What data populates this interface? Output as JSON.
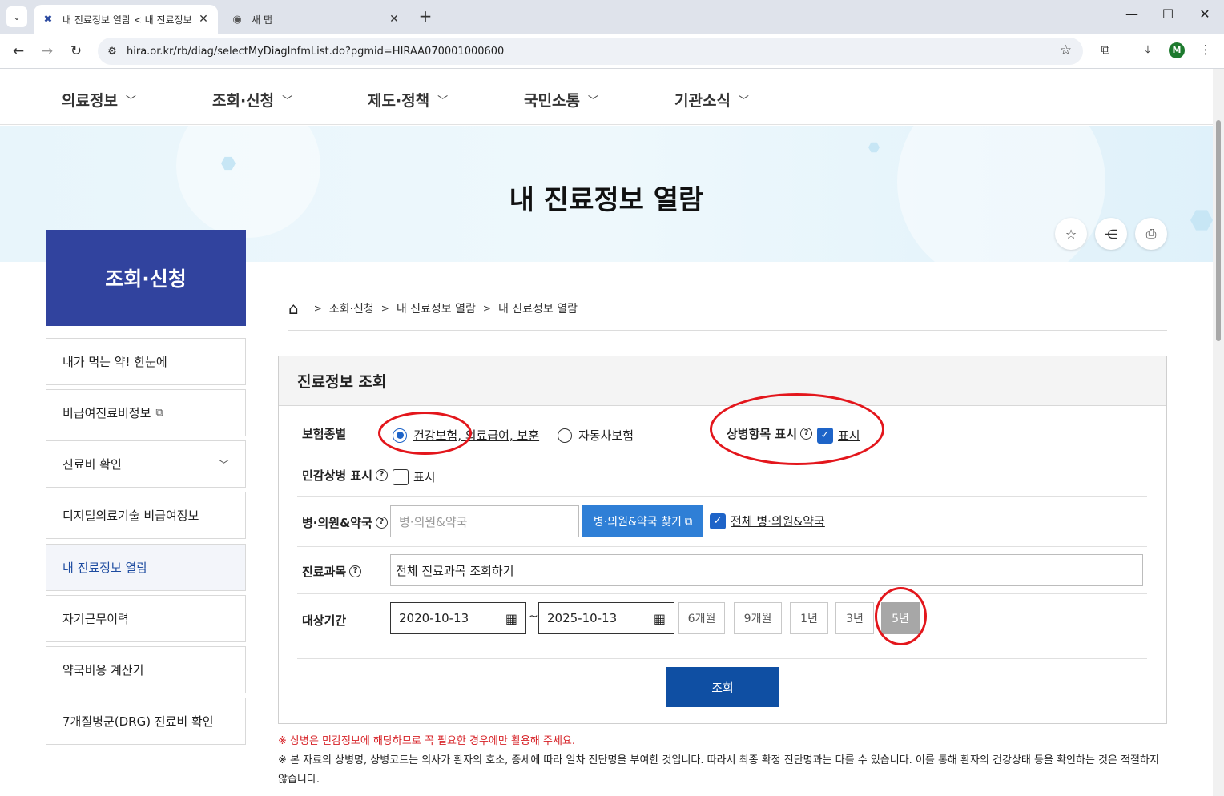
{
  "browser": {
    "tabs": [
      {
        "title": "내 진료정보 열람 < 내 진료정보",
        "favicon": "hira-icon",
        "active": true
      },
      {
        "title": "새 탭",
        "favicon": "chrome-icon",
        "active": false
      }
    ],
    "url": "hira.or.kr/rb/diag/selectMyDiagInfmList.do?pgmid=HIRAA070001000600",
    "profile_initial": "M"
  },
  "gnb": {
    "items": [
      {
        "label": "의료정보"
      },
      {
        "label": "조회·신청"
      },
      {
        "label": "제도·정책"
      },
      {
        "label": "국민소통"
      },
      {
        "label": "기관소식"
      }
    ]
  },
  "hero": {
    "title": "내 진료정보 열람"
  },
  "sidebar": {
    "heading": "조회·신청",
    "items": [
      {
        "label": "내가 먹는 약! 한눈에"
      },
      {
        "label": "비급여진료비정보"
      },
      {
        "label": "진료비 확인"
      },
      {
        "label": "디지털의료기술 비급여정보"
      },
      {
        "label": "내 진료정보 열람"
      },
      {
        "label": "자기근무이력"
      },
      {
        "label": "약국비용 계산기"
      },
      {
        "label": "7개질병군(DRG) 진료비 확인"
      }
    ]
  },
  "breadcrumb": [
    "조회·신청",
    "내 진료정보 열람",
    "내 진료정보 열람"
  ],
  "search": {
    "title": "진료정보 조회",
    "insurance_label": "보험종별",
    "insurance_options": [
      {
        "label": "건강보험, 의료급여, 보훈",
        "selected": true
      },
      {
        "label": "자동차보험",
        "selected": false
      }
    ],
    "disease_display_label": "상병항목 표시",
    "disease_display_check": "표시",
    "sensitive_label": "민감상병 표시",
    "sensitive_check": "표시",
    "hospital_label": "병·의원&약국",
    "hospital_placeholder": "병·의원&약국",
    "hospital_find_button": "병·의원&약국 찾기",
    "hospital_all_check": "전체 병·의원&약국",
    "dept_label": "진료과목",
    "dept_value": "전체 진료과목 조회하기",
    "period_label": "대상기간",
    "date_from": "2020-10-13",
    "date_to": "2025-10-13",
    "date_sep": "~",
    "periods": [
      "6개월",
      "9개월",
      "1년",
      "3년",
      "5년"
    ],
    "selected_period": "5년",
    "submit": "조회"
  },
  "notes": {
    "warning": "※ 상병은 민감정보에 해당하므로 꼭 필요한 경우에만 활용해 주세요.",
    "info": "※ 본 자료의 상병명, 상병코드는 의사가 환자의 호소, 증세에 따라 일차 진단명을 부여한 것입니다. 따라서 최종 확정 진단명과는 다를 수 있습니다. 이를 통해 환자의 건강상태 등을 확인하는 것은 적절하지",
    "info_cont": "않습니다."
  },
  "colors": {
    "sidebar_head": "#31439e",
    "primary_button": "#0f4fa3",
    "find_button": "#2f7fd6",
    "annotation_ring": "#e3161c",
    "warning_text": "#d61f24"
  }
}
